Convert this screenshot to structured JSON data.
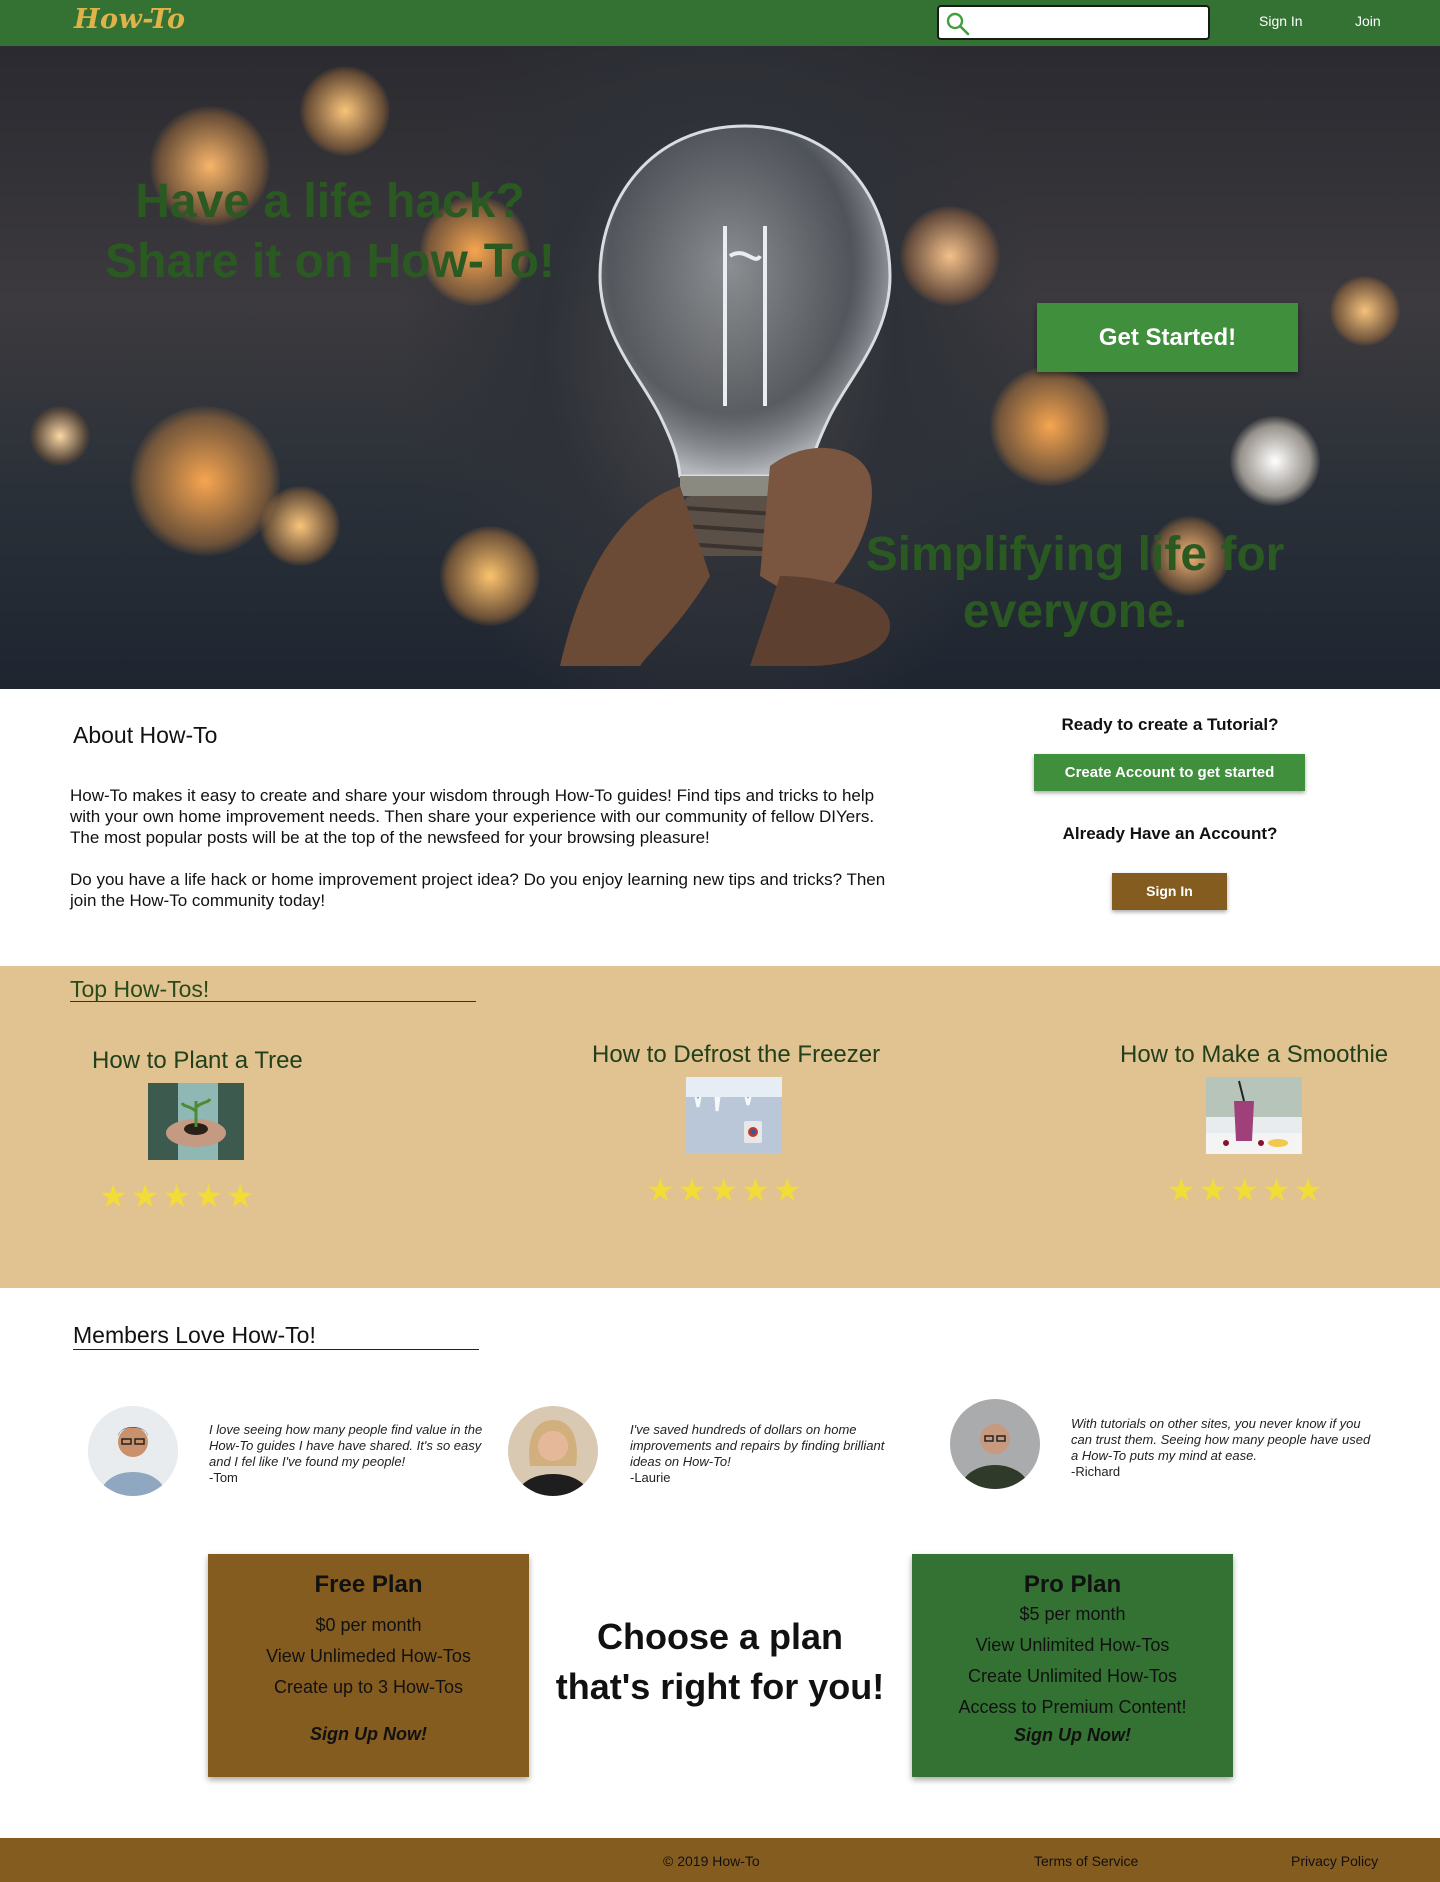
{
  "nav": {
    "logo": "How-To",
    "search_placeholder": "",
    "signin": "Sign In",
    "join": "Join"
  },
  "hero": {
    "title": "Have a life hack? Share it on How-To!",
    "cta": "Get Started!",
    "tagline": "Simplifying life for everyone."
  },
  "about": {
    "title": "About How-To",
    "p1": "How-To makes it easy to create and share your wisdom through How-To guides! Find tips and tricks to help with your own home improvement needs. Then share your experience with our community of fellow DIYers. The most popular posts will be at the top of the newsfeed for your browsing pleasure!",
    "p2": "Do you have a life hack or home improvement project idea? Do you enjoy learning new tips and tricks? Then join the How-To community today!",
    "ready": "Ready to create a Tutorial?",
    "create_btn": "Create Account to get started",
    "already": "Already Have an Account?",
    "signin_btn": "Sign In"
  },
  "top": {
    "title": "Top How-Tos!",
    "cards": [
      {
        "title": "How to Plant a Tree",
        "rating": 5,
        "stars": "★★★★★"
      },
      {
        "title": "How to Defrost the Freezer",
        "rating": 5,
        "stars": "★★★★★"
      },
      {
        "title": "How to Make a Smoothie",
        "rating": 5,
        "stars": "★★★★★"
      }
    ]
  },
  "members": {
    "title": "Members Love How-To!",
    "testimonials": [
      {
        "quote": "I love seeing how many people find value in the How-To guides I have have shared. It's so easy and I fel like I've found my people!",
        "author": "-Tom"
      },
      {
        "quote": "I've saved hundreds of dollars on home improvements and repairs by finding brilliant ideas on How-To!",
        "author": "-Laurie"
      },
      {
        "quote": "With tutorials on other sites, you never know if you can trust them. Seeing how many people have used a How-To puts my mind at ease.",
        "author": "-Richard"
      }
    ]
  },
  "plans": {
    "choose": "Choose a plan that's right for you!",
    "free": {
      "title": "Free Plan",
      "price": "$0 per month",
      "f1": "View Unlimeded How-Tos",
      "f2": "Create up to 3 How-Tos",
      "signup": "Sign Up Now!",
      "color": "#855c1f"
    },
    "pro": {
      "title": "Pro Plan",
      "price": "$5 per month",
      "f1": "View Unlimited How-Tos",
      "f2": "Create Unlimited How-Tos",
      "f3": "Access to Premium Content!",
      "signup": "Sign Up Now!",
      "color": "#347233"
    }
  },
  "footer": {
    "copyright": "© 2019 How-To",
    "terms": "Terms of Service",
    "privacy": "Privacy Policy"
  },
  "colors": {
    "nav_green": "#347233",
    "accent_green": "#3f8f3d",
    "brown": "#855c1f",
    "tan": "#e1c291",
    "star": "#f2dc36"
  }
}
